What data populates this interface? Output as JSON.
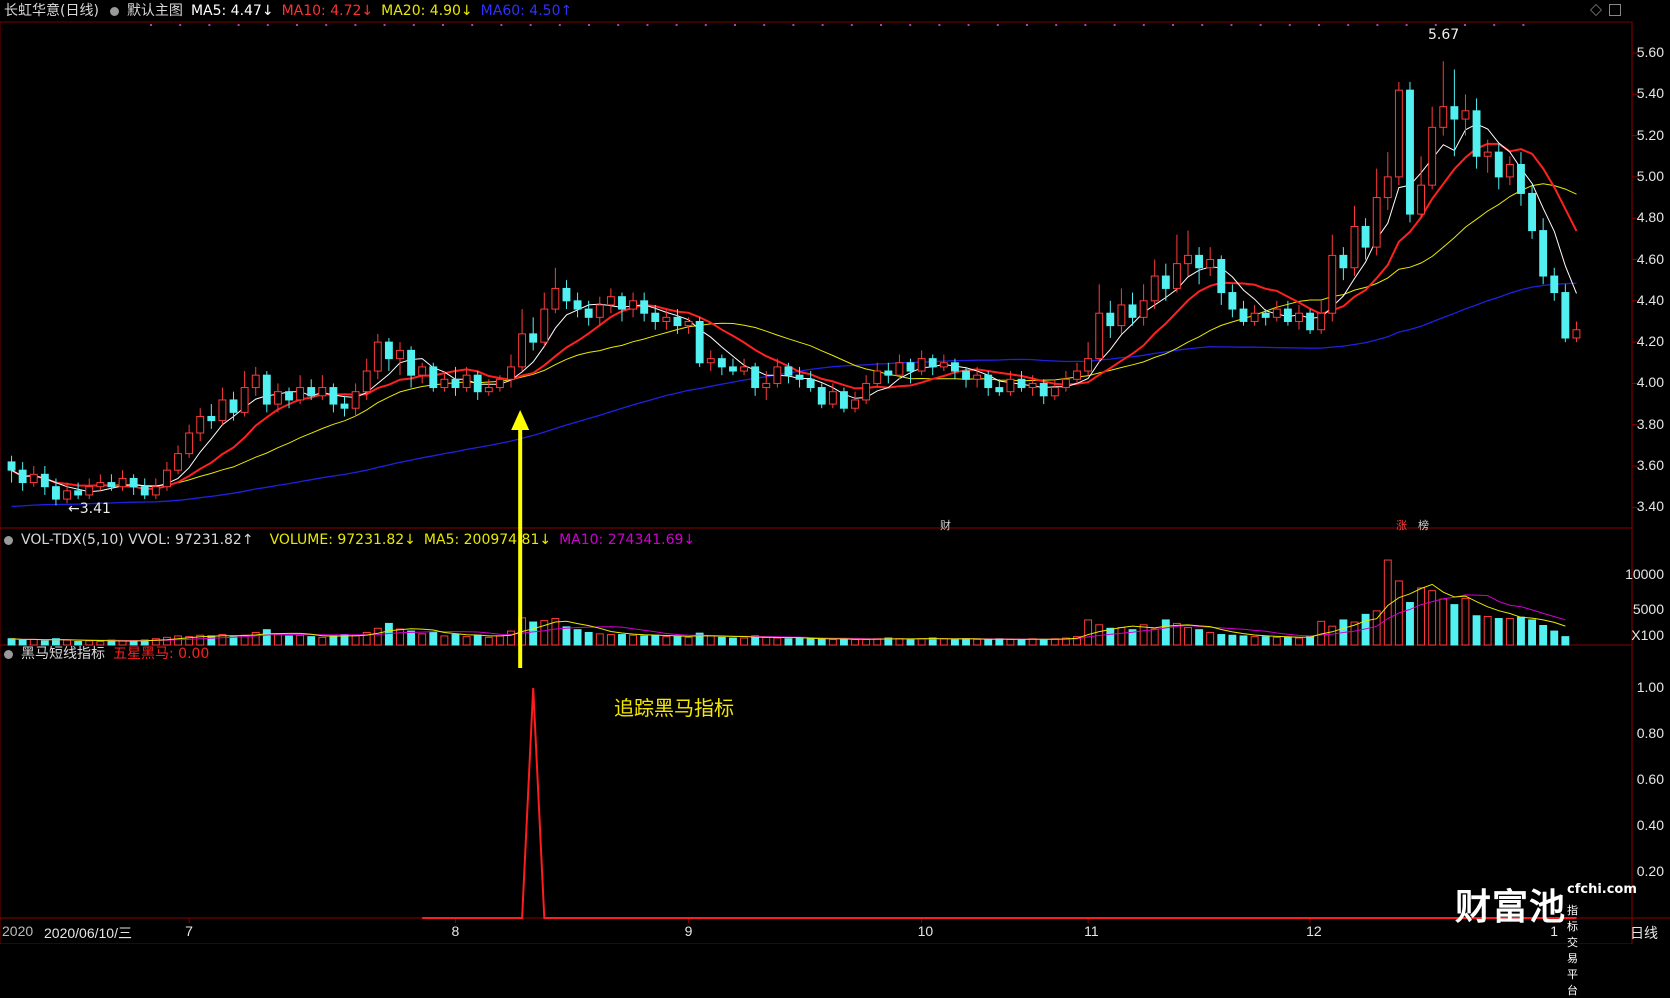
{
  "header": {
    "stock_name": "长虹华意(日线)",
    "main_chart": "默认主图",
    "ma5": "MA5: 4.47↓",
    "ma10": "MA10: 4.72↓",
    "ma20": "MA20: 4.90↓",
    "ma60": "MA60: 4.50↑"
  },
  "volume_header": {
    "indicator": "VOL-TDX(5,10) VVOL: 97231.82↑",
    "volume": "VOLUME: 97231.82↓",
    "ma5": "MA5: 200974.81↓",
    "ma10": "MA10: 274341.69↓"
  },
  "indicator_header": {
    "name": "黑马短线指标",
    "value": "五星黑马: 0.00"
  },
  "price_axis": [
    "5.60",
    "5.40",
    "5.20",
    "5.00",
    "4.80",
    "4.60",
    "4.40",
    "4.20",
    "4.00",
    "3.80",
    "3.60",
    "3.40"
  ],
  "volume_axis": [
    "10000",
    "5000",
    "X100"
  ],
  "indicator_axis": [
    "1.00",
    "0.80",
    "0.60",
    "0.40",
    "0.20"
  ],
  "x_axis": {
    "date_label": "2020/06/10/三",
    "year_prefix": "2020",
    "months": [
      "7",
      "8",
      "9",
      "10",
      "11",
      "12",
      "1"
    ],
    "period_label": "日线"
  },
  "annotations": {
    "high": "5.67",
    "low": "←3.41",
    "note": "追踪黑马指标",
    "marker_cai": "财",
    "marker_zhang": "涨",
    "marker_bang": "榜"
  },
  "logo": {
    "brand": "财富池",
    "site": "cfchi.com",
    "tagline": "指标交易平台"
  },
  "colors": {
    "up": "#ff3a3a",
    "down": "#52f0f0",
    "ma5": "#ffffff",
    "ma10": "#ff2020",
    "ma20": "#e8e800",
    "ma60": "#2020e0",
    "vol_ma5": "#e8e800",
    "vol_ma10": "#d000d0",
    "signal": "#ff1c1c",
    "arrow": "#ffff00"
  },
  "chart_data": {
    "type": "candlestick",
    "price_range": [
      3.3,
      5.75
    ],
    "volume_range": [
      0,
      13500
    ],
    "indicator_range": [
      0,
      1.1
    ],
    "candles": [
      [
        3.62,
        3.58,
        3.65,
        3.52
      ],
      [
        3.58,
        3.52,
        3.62,
        3.48
      ],
      [
        3.52,
        3.56,
        3.6,
        3.5
      ],
      [
        3.56,
        3.5,
        3.6,
        3.46
      ],
      [
        3.5,
        3.44,
        3.54,
        3.41
      ],
      [
        3.44,
        3.48,
        3.52,
        3.42
      ],
      [
        3.48,
        3.46,
        3.52,
        3.44
      ],
      [
        3.46,
        3.5,
        3.54,
        3.44
      ],
      [
        3.5,
        3.52,
        3.56,
        3.48
      ],
      [
        3.52,
        3.5,
        3.56,
        3.48
      ],
      [
        3.5,
        3.54,
        3.58,
        3.48
      ],
      [
        3.54,
        3.5,
        3.56,
        3.46
      ],
      [
        3.5,
        3.46,
        3.54,
        3.44
      ],
      [
        3.46,
        3.5,
        3.54,
        3.44
      ],
      [
        3.5,
        3.58,
        3.62,
        3.48
      ],
      [
        3.58,
        3.66,
        3.7,
        3.56
      ],
      [
        3.66,
        3.76,
        3.8,
        3.64
      ],
      [
        3.76,
        3.84,
        3.88,
        3.72
      ],
      [
        3.84,
        3.82,
        3.9,
        3.78
      ],
      [
        3.82,
        3.92,
        3.98,
        3.8
      ],
      [
        3.92,
        3.86,
        3.96,
        3.82
      ],
      [
        3.86,
        3.98,
        4.06,
        3.84
      ],
      [
        3.98,
        4.04,
        4.08,
        3.94
      ],
      [
        4.04,
        3.9,
        4.06,
        3.86
      ],
      [
        3.9,
        3.96,
        4.0,
        3.86
      ],
      [
        3.96,
        3.92,
        3.98,
        3.88
      ],
      [
        3.92,
        3.98,
        4.04,
        3.9
      ],
      [
        3.98,
        3.94,
        4.02,
        3.92
      ],
      [
        3.94,
        3.98,
        4.04,
        3.92
      ],
      [
        3.98,
        3.9,
        4.0,
        3.86
      ],
      [
        3.9,
        3.88,
        3.94,
        3.84
      ],
      [
        3.88,
        3.96,
        4.0,
        3.84
      ],
      [
        3.96,
        4.06,
        4.12,
        3.92
      ],
      [
        4.06,
        4.2,
        4.24,
        4.02
      ],
      [
        4.2,
        4.12,
        4.22,
        4.06
      ],
      [
        4.12,
        4.16,
        4.2,
        4.04
      ],
      [
        4.16,
        4.04,
        4.18,
        3.98
      ],
      [
        4.04,
        4.08,
        4.1,
        4.0
      ],
      [
        4.08,
        3.98,
        4.1,
        3.96
      ],
      [
        3.98,
        4.02,
        4.06,
        3.96
      ],
      [
        4.02,
        3.98,
        4.08,
        3.94
      ],
      [
        3.98,
        4.04,
        4.08,
        3.96
      ],
      [
        4.04,
        3.96,
        4.06,
        3.92
      ],
      [
        3.96,
        3.98,
        4.02,
        3.94
      ],
      [
        3.98,
        4.02,
        4.04,
        3.96
      ],
      [
        4.02,
        4.08,
        4.14,
        3.98
      ],
      [
        4.08,
        4.24,
        4.36,
        4.06
      ],
      [
        4.24,
        4.2,
        4.32,
        4.16
      ],
      [
        4.2,
        4.36,
        4.44,
        4.18
      ],
      [
        4.36,
        4.46,
        4.56,
        4.34
      ],
      [
        4.46,
        4.4,
        4.5,
        4.36
      ],
      [
        4.4,
        4.36,
        4.44,
        4.32
      ],
      [
        4.36,
        4.32,
        4.4,
        4.28
      ],
      [
        4.32,
        4.38,
        4.42,
        4.28
      ],
      [
        4.38,
        4.42,
        4.46,
        4.34
      ],
      [
        4.42,
        4.36,
        4.44,
        4.3
      ],
      [
        4.36,
        4.4,
        4.44,
        4.32
      ],
      [
        4.4,
        4.34,
        4.44,
        4.3
      ],
      [
        4.34,
        4.3,
        4.38,
        4.26
      ],
      [
        4.3,
        4.32,
        4.36,
        4.26
      ],
      [
        4.32,
        4.28,
        4.36,
        4.24
      ],
      [
        4.28,
        4.3,
        4.32,
        4.24
      ],
      [
        4.3,
        4.1,
        4.32,
        4.08
      ],
      [
        4.1,
        4.12,
        4.16,
        4.06
      ],
      [
        4.12,
        4.08,
        4.14,
        4.04
      ],
      [
        4.08,
        4.06,
        4.12,
        4.04
      ],
      [
        4.06,
        4.08,
        4.12,
        4.04
      ],
      [
        4.08,
        3.98,
        4.1,
        3.94
      ],
      [
        3.98,
        4.0,
        4.06,
        3.92
      ],
      [
        4.0,
        4.08,
        4.12,
        3.98
      ],
      [
        4.08,
        4.04,
        4.1,
        4.0
      ],
      [
        4.04,
        4.02,
        4.08,
        3.98
      ],
      [
        4.02,
        3.98,
        4.06,
        3.96
      ],
      [
        3.98,
        3.9,
        4.0,
        3.88
      ],
      [
        3.9,
        3.96,
        4.0,
        3.88
      ],
      [
        3.96,
        3.88,
        3.98,
        3.86
      ],
      [
        3.88,
        3.92,
        3.96,
        3.86
      ],
      [
        3.92,
        4.0,
        4.04,
        3.9
      ],
      [
        4.0,
        4.06,
        4.1,
        3.98
      ],
      [
        4.06,
        4.04,
        4.1,
        4.0
      ],
      [
        4.04,
        4.1,
        4.14,
        4.02
      ],
      [
        4.1,
        4.06,
        4.12,
        4.0
      ],
      [
        4.06,
        4.12,
        4.16,
        4.04
      ],
      [
        4.12,
        4.08,
        4.14,
        4.04
      ],
      [
        4.08,
        4.1,
        4.14,
        4.06
      ],
      [
        4.1,
        4.06,
        4.12,
        4.02
      ],
      [
        4.06,
        4.02,
        4.08,
        3.98
      ],
      [
        4.02,
        4.04,
        4.08,
        3.98
      ],
      [
        4.04,
        3.98,
        4.06,
        3.94
      ],
      [
        3.98,
        3.96,
        4.02,
        3.94
      ],
      [
        3.96,
        4.02,
        4.06,
        3.94
      ],
      [
        4.02,
        3.98,
        4.06,
        3.96
      ],
      [
        3.98,
        4.0,
        4.04,
        3.94
      ],
      [
        4.0,
        3.94,
        4.02,
        3.9
      ],
      [
        3.94,
        3.98,
        4.02,
        3.92
      ],
      [
        3.98,
        4.02,
        4.06,
        3.96
      ],
      [
        4.02,
        4.06,
        4.1,
        4.0
      ],
      [
        4.06,
        4.12,
        4.2,
        4.04
      ],
      [
        4.12,
        4.34,
        4.48,
        4.1
      ],
      [
        4.34,
        4.28,
        4.4,
        4.22
      ],
      [
        4.28,
        4.38,
        4.46,
        4.24
      ],
      [
        4.38,
        4.32,
        4.44,
        4.28
      ],
      [
        4.32,
        4.4,
        4.48,
        4.28
      ],
      [
        4.4,
        4.52,
        4.6,
        4.36
      ],
      [
        4.52,
        4.46,
        4.58,
        4.4
      ],
      [
        4.46,
        4.58,
        4.72,
        4.44
      ],
      [
        4.58,
        4.62,
        4.74,
        4.52
      ],
      [
        4.62,
        4.56,
        4.66,
        4.48
      ],
      [
        4.56,
        4.6,
        4.66,
        4.52
      ],
      [
        4.6,
        4.44,
        4.62,
        4.38
      ],
      [
        4.44,
        4.36,
        4.48,
        4.32
      ],
      [
        4.36,
        4.3,
        4.4,
        4.28
      ],
      [
        4.3,
        4.34,
        4.38,
        4.28
      ],
      [
        4.34,
        4.32,
        4.36,
        4.28
      ],
      [
        4.32,
        4.36,
        4.4,
        4.3
      ],
      [
        4.36,
        4.3,
        4.4,
        4.28
      ],
      [
        4.3,
        4.34,
        4.38,
        4.26
      ],
      [
        4.34,
        4.26,
        4.36,
        4.24
      ],
      [
        4.26,
        4.34,
        4.4,
        4.24
      ],
      [
        4.34,
        4.62,
        4.72,
        4.3
      ],
      [
        4.62,
        4.56,
        4.66,
        4.5
      ],
      [
        4.56,
        4.76,
        4.86,
        4.52
      ],
      [
        4.76,
        4.66,
        4.8,
        4.6
      ],
      [
        4.66,
        4.9,
        5.04,
        4.62
      ],
      [
        4.9,
        5.0,
        5.12,
        4.84
      ],
      [
        5.0,
        5.42,
        5.46,
        4.96
      ],
      [
        5.42,
        4.82,
        5.46,
        4.78
      ],
      [
        4.82,
        4.96,
        5.1,
        4.8
      ],
      [
        4.96,
        5.24,
        5.34,
        4.94
      ],
      [
        5.24,
        5.34,
        5.56,
        5.2
      ],
      [
        5.34,
        5.28,
        5.52,
        5.1
      ],
      [
        5.28,
        5.32,
        5.4,
        5.2
      ],
      [
        5.32,
        5.1,
        5.38,
        5.04
      ],
      [
        5.1,
        5.12,
        5.18,
        5.02
      ],
      [
        5.12,
        5.0,
        5.16,
        4.94
      ],
      [
        5.0,
        5.06,
        5.1,
        4.96
      ],
      [
        5.06,
        4.92,
        5.12,
        4.86
      ],
      [
        4.92,
        4.74,
        4.96,
        4.7
      ],
      [
        4.74,
        4.52,
        4.8,
        4.48
      ],
      [
        4.52,
        4.44,
        4.56,
        4.4
      ],
      [
        4.44,
        4.22,
        4.48,
        4.2
      ],
      [
        4.22,
        4.26,
        4.3,
        4.2
      ]
    ],
    "volume": [
      900,
      700,
      800,
      600,
      900,
      700,
      500,
      600,
      500,
      700,
      600,
      500,
      700,
      900,
      1100,
      1300,
      1200,
      1400,
      1300,
      1500,
      1200,
      1400,
      1800,
      2200,
      1600,
      1300,
      1400,
      1200,
      1100,
      1300,
      1500,
      1400,
      1800,
      2400,
      3100,
      2300,
      2000,
      1600,
      1800,
      1300,
      1500,
      1200,
      1400,
      1100,
      1300,
      2000,
      3900,
      3300,
      3500,
      3800,
      2600,
      2200,
      1800,
      1600,
      1500,
      1500,
      1400,
      1300,
      1400,
      1200,
      1200,
      1100,
      1700,
      1300,
      1100,
      1000,
      1000,
      1300,
      1100,
      1000,
      900,
      1000,
      900,
      800,
      800,
      900,
      800,
      800,
      900,
      1000,
      900,
      800,
      900,
      1000,
      900,
      800,
      900,
      800,
      800,
      900,
      800,
      700,
      900,
      800,
      900,
      1000,
      1200,
      3600,
      2900,
      2400,
      2500,
      2200,
      2900,
      2300,
      3600,
      3100,
      2500,
      2200,
      1800,
      1500,
      1400,
      1300,
      1200,
      1200,
      1100,
      1100,
      1000,
      1300,
      3400,
      2700,
      3600,
      3300,
      4400,
      4900,
      12200,
      9200,
      6100,
      8200,
      7800,
      6600,
      5800,
      6700,
      4200,
      4100,
      3800,
      3800,
      4000,
      3600,
      2800,
      2000,
      1200
    ],
    "signal_index": 47,
    "ma_overlays": [
      "MA5",
      "MA10",
      "MA20",
      "MA60"
    ]
  }
}
